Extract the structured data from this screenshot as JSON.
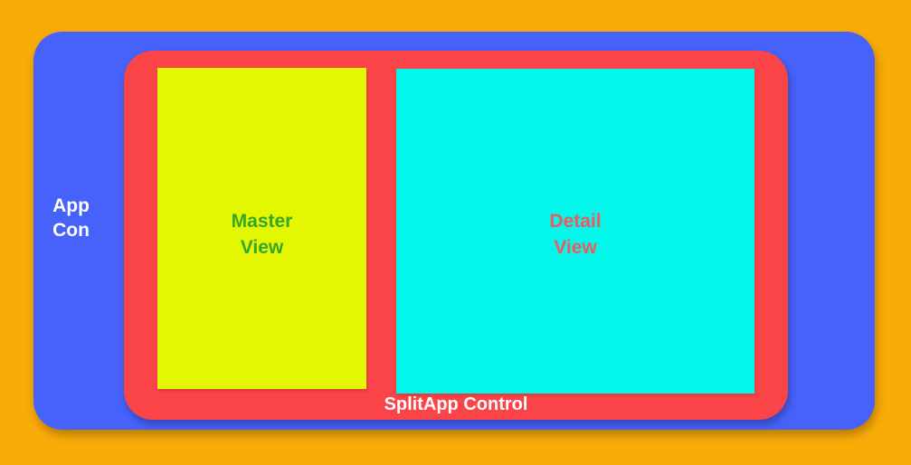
{
  "colors": {
    "background": "#F9AC08",
    "app_container": "#4662FA",
    "splitapp_control": "#FB4447",
    "master_view": "#E3F703",
    "detail_view": "#02F8EA",
    "master_text": "#36A62A",
    "detail_text": "#EE5A5E"
  },
  "app_container": {
    "label_line1": "App",
    "label_line2": "Con"
  },
  "splitapp": {
    "label": "SplitApp Control"
  },
  "master_view": {
    "label_line1": "Master",
    "label_line2": "View"
  },
  "detail_view": {
    "label_line1": "Detail",
    "label_line2": "View"
  }
}
